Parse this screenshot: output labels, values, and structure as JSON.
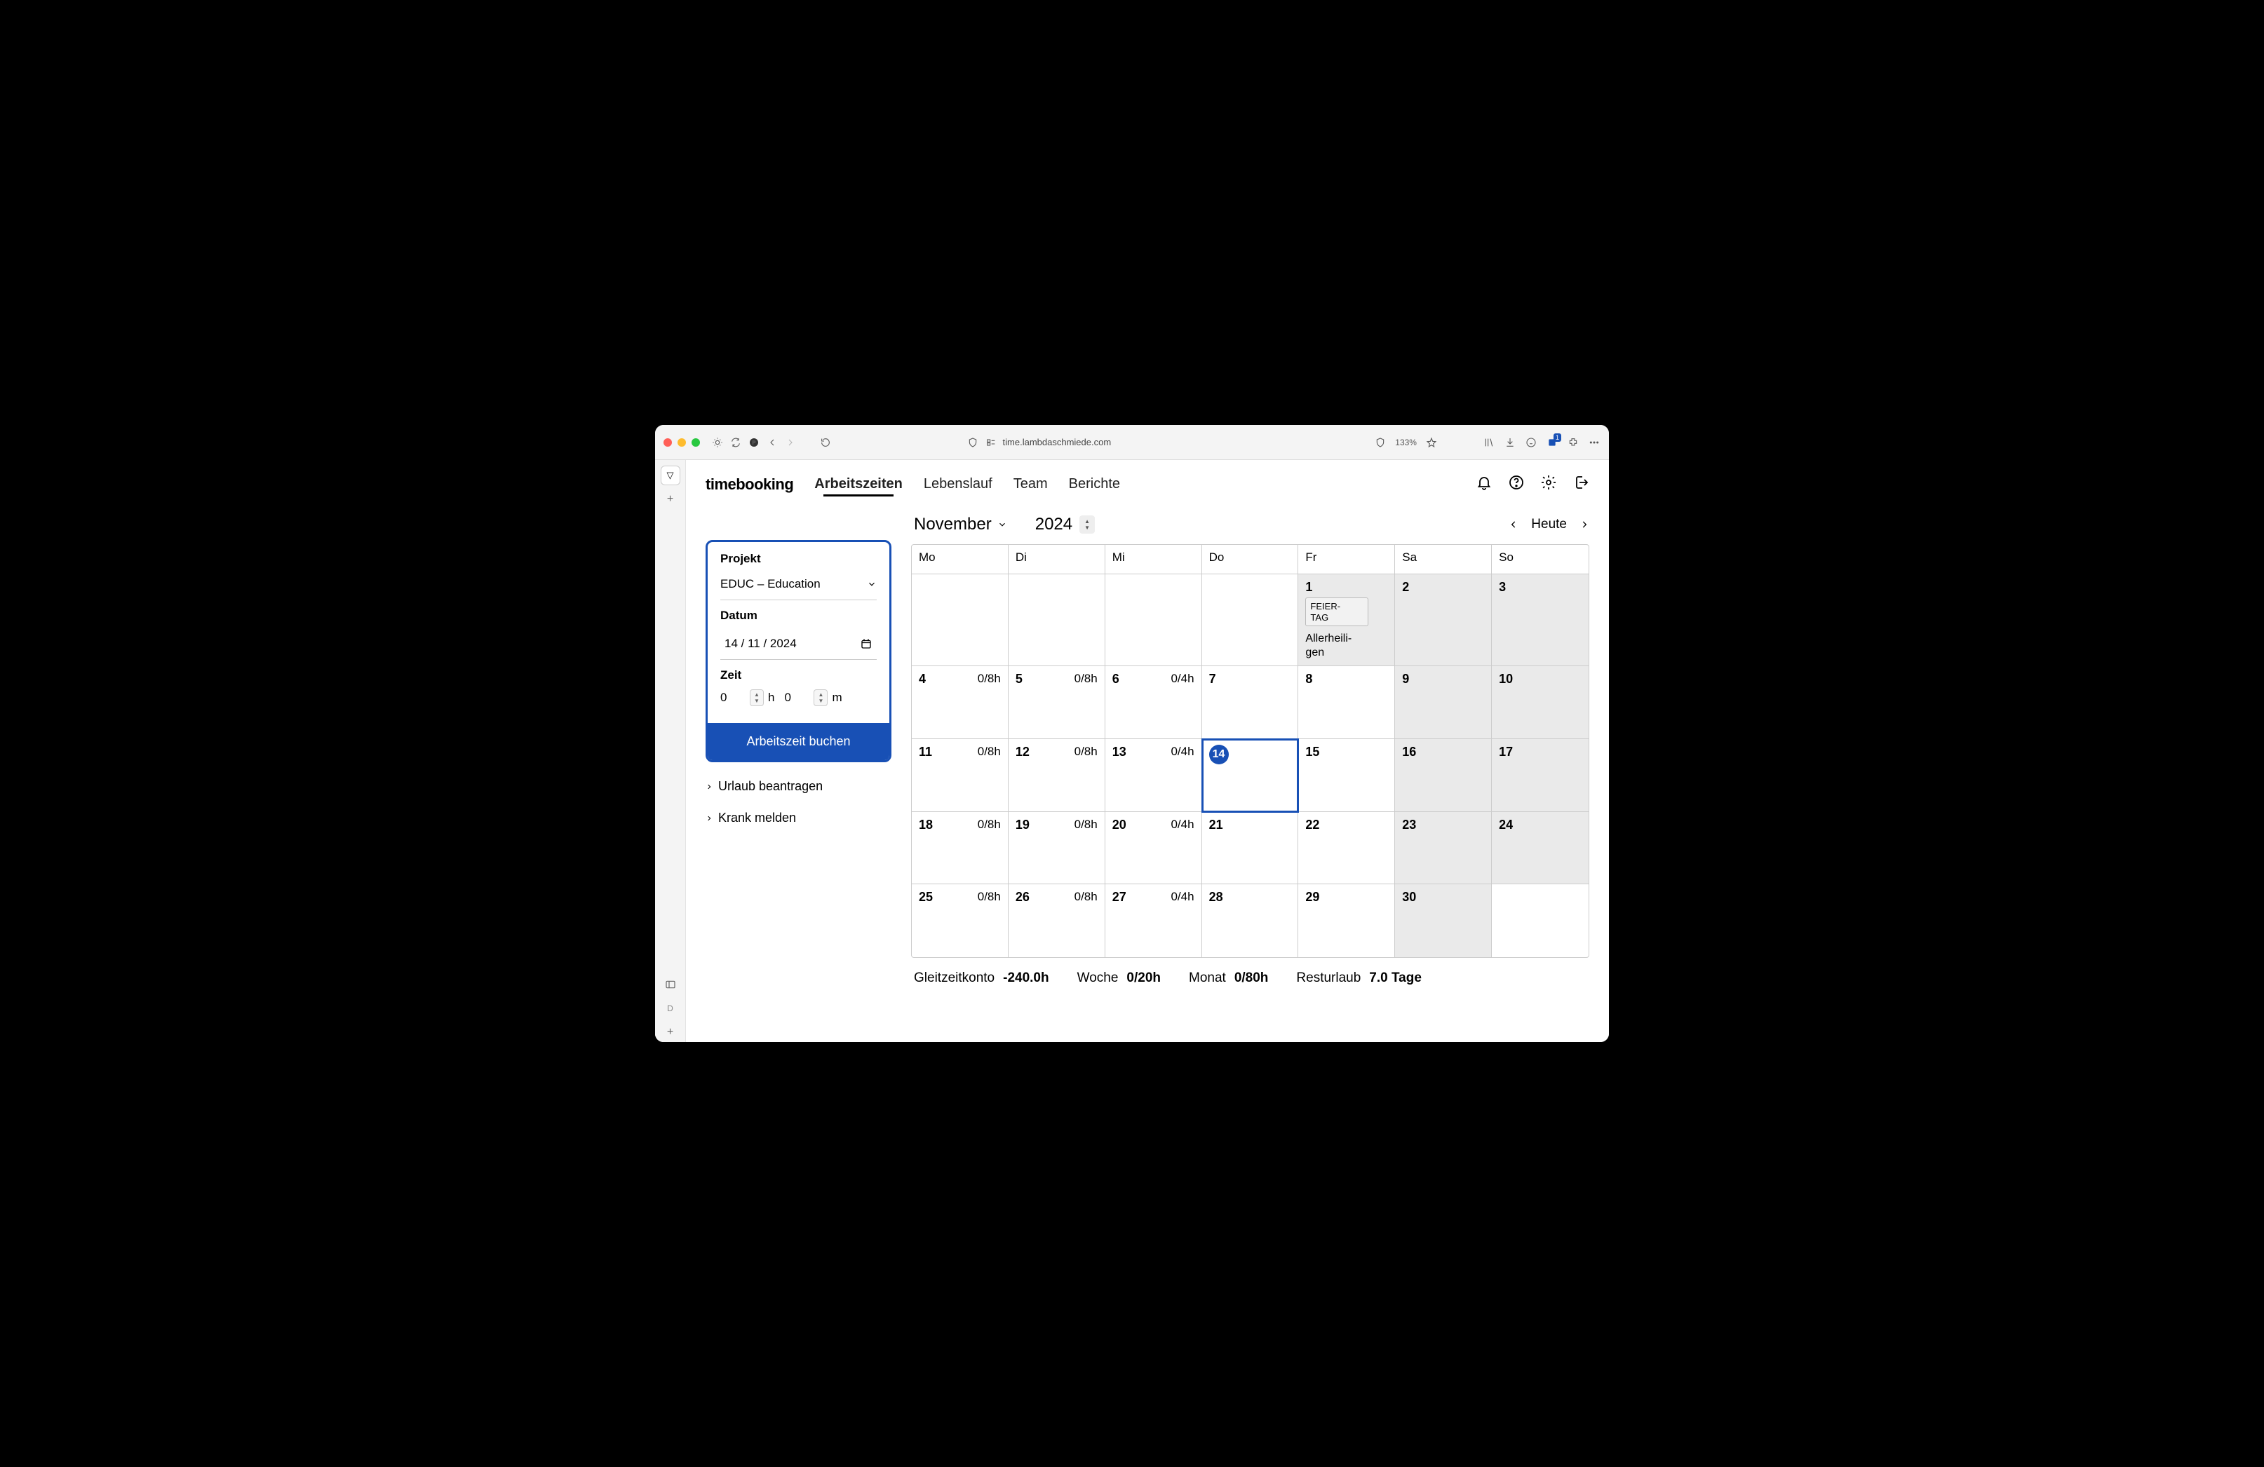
{
  "chrome": {
    "url": "time.lambdaschmiede.com",
    "zoom": "133%"
  },
  "brand": "timebooking",
  "nav": {
    "items": [
      "Arbeitszeiten",
      "Lebenslauf",
      "Team",
      "Berichte"
    ],
    "active": 0
  },
  "sidebar": {
    "project_label": "Projekt",
    "project_value": "EDUC – Education",
    "date_label": "Datum",
    "date_value": "14 / 11 / 2024",
    "time_label": "Zeit",
    "hours_value": "0",
    "hours_unit": "h",
    "mins_value": "0",
    "mins_unit": "m",
    "book_button": "Arbeitszeit buchen",
    "links": [
      "Urlaub beantragen",
      "Krank melden"
    ]
  },
  "calendar": {
    "month": "November",
    "year": "2024",
    "today_label": "Heute",
    "weekdays": [
      "Mo",
      "Di",
      "Mi",
      "Do",
      "Fr",
      "Sa",
      "So"
    ],
    "cells": [
      {
        "day": "",
        "hours": "",
        "type": "blank"
      },
      {
        "day": "",
        "hours": "",
        "type": "blank"
      },
      {
        "day": "",
        "hours": "",
        "type": "blank"
      },
      {
        "day": "",
        "hours": "",
        "type": "blank"
      },
      {
        "day": "1",
        "type": "holiday",
        "tag": "FEIERTAG",
        "holiday": "Allerheiligen"
      },
      {
        "day": "2",
        "type": "wknd"
      },
      {
        "day": "3",
        "type": "wknd"
      },
      {
        "day": "4",
        "hours": "0/8h",
        "type": "work"
      },
      {
        "day": "5",
        "hours": "0/8h",
        "type": "work"
      },
      {
        "day": "6",
        "hours": "0/4h",
        "type": "work"
      },
      {
        "day": "7",
        "type": "work"
      },
      {
        "day": "8",
        "type": "work"
      },
      {
        "day": "9",
        "type": "wknd"
      },
      {
        "day": "10",
        "type": "wknd"
      },
      {
        "day": "11",
        "hours": "0/8h",
        "type": "work"
      },
      {
        "day": "12",
        "hours": "0/8h",
        "type": "work"
      },
      {
        "day": "13",
        "hours": "0/4h",
        "type": "work"
      },
      {
        "day": "14",
        "type": "today"
      },
      {
        "day": "15",
        "type": "work"
      },
      {
        "day": "16",
        "type": "wknd"
      },
      {
        "day": "17",
        "type": "wknd"
      },
      {
        "day": "18",
        "hours": "0/8h",
        "type": "work"
      },
      {
        "day": "19",
        "hours": "0/8h",
        "type": "work"
      },
      {
        "day": "20",
        "hours": "0/4h",
        "type": "work"
      },
      {
        "day": "21",
        "type": "work"
      },
      {
        "day": "22",
        "type": "work"
      },
      {
        "day": "23",
        "type": "wknd"
      },
      {
        "day": "24",
        "type": "wknd"
      },
      {
        "day": "25",
        "hours": "0/8h",
        "type": "work"
      },
      {
        "day": "26",
        "hours": "0/8h",
        "type": "work"
      },
      {
        "day": "27",
        "hours": "0/4h",
        "type": "work"
      },
      {
        "day": "28",
        "type": "work"
      },
      {
        "day": "29",
        "type": "work"
      },
      {
        "day": "30",
        "type": "wknd"
      },
      {
        "day": "",
        "type": "blank"
      }
    ]
  },
  "summary": {
    "pairs": [
      {
        "label": "Gleitzeitkonto",
        "value": "-240.0h"
      },
      {
        "label": "Woche",
        "value": "0/20h"
      },
      {
        "label": "Monat",
        "value": "0/80h"
      },
      {
        "label": "Resturlaub",
        "value": "7.0 Tage"
      }
    ]
  },
  "tabstrip": {
    "letter": "D"
  }
}
